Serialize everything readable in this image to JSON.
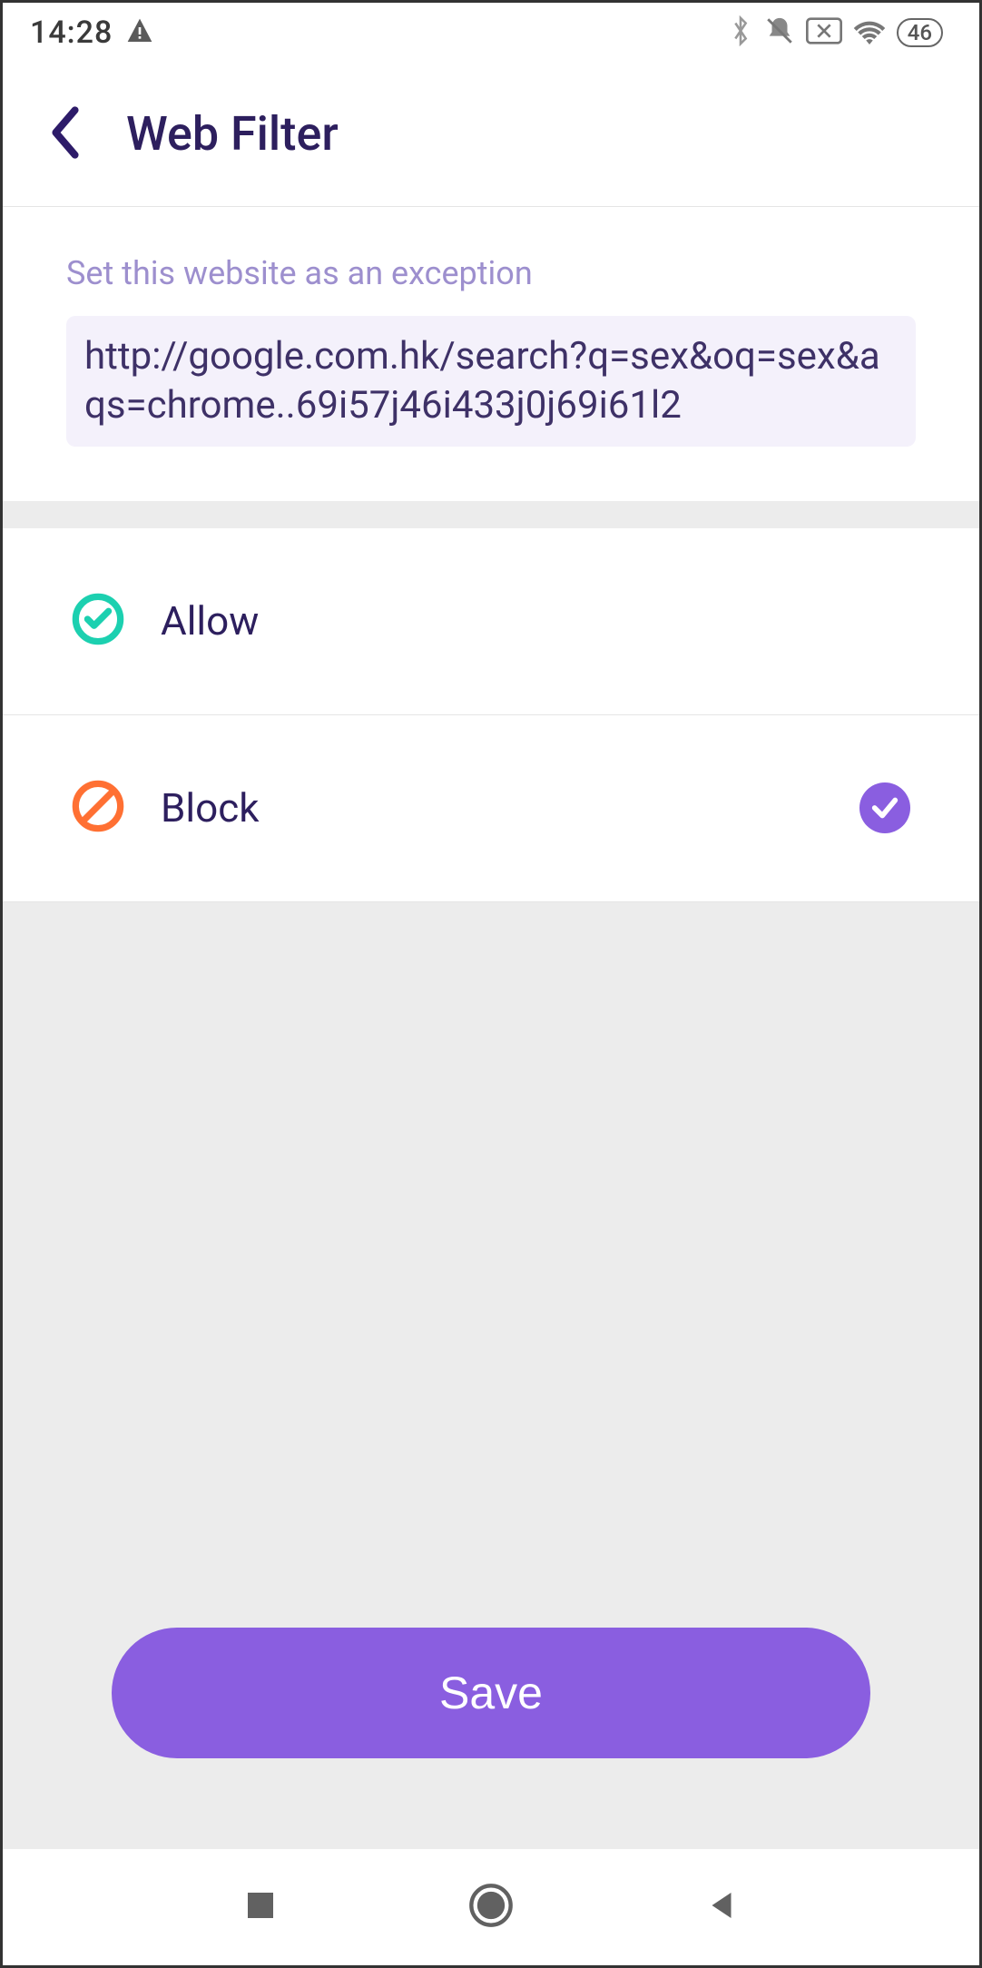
{
  "status_bar": {
    "time": "14:28",
    "battery": "46"
  },
  "header": {
    "title": "Web Filter"
  },
  "exception": {
    "caption": "Set this website as an exception",
    "url": "http://google.com.hk/search?q=sex&oq=sex&aqs=chrome..69i57j46i433j0j69i61l2"
  },
  "options": {
    "allow": {
      "label": "Allow",
      "selected": false
    },
    "block": {
      "label": "Block",
      "selected": true
    }
  },
  "actions": {
    "save": "Save"
  }
}
